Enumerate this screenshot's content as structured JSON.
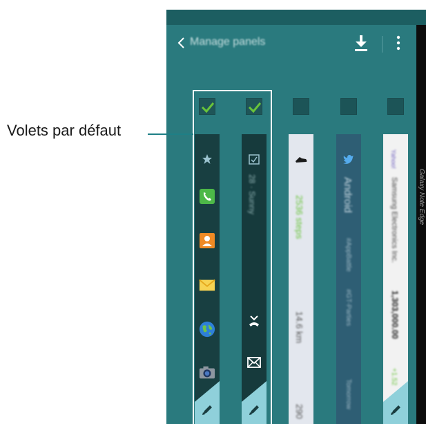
{
  "callout": {
    "label": "Volets par défaut"
  },
  "colors": {
    "accent": "#2a7a7e",
    "check": "#69c43a"
  },
  "status_bar": {
    "text": ""
  },
  "action_bar": {
    "title": "Manage panels"
  },
  "side_screen": {
    "text": "Galaxy Note Edge"
  },
  "panels": [
    {
      "name": "favourites",
      "checked": true,
      "icons": [
        "star-icon",
        "phone-icon",
        "contacts-icon",
        "email-icon",
        "internet-icon",
        "camera-icon"
      ]
    },
    {
      "name": "tasks",
      "checked": true,
      "icons": [
        "task-icon",
        "missed-call-icon",
        "message-icon"
      ]
    },
    {
      "name": "health",
      "checked": false,
      "icons": [
        "shoe-icon"
      ]
    },
    {
      "name": "twitter",
      "checked": false,
      "icons": [
        "twitter-icon"
      ]
    },
    {
      "name": "stocks",
      "checked": false,
      "icons": []
    }
  ]
}
